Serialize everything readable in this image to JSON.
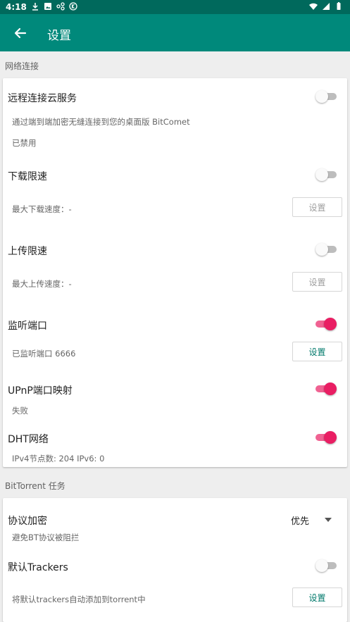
{
  "status_bar": {
    "time": "4:18"
  },
  "app_bar": {
    "title": "设置"
  },
  "sections": {
    "network": {
      "header": "网络连接",
      "remote": {
        "title": "远程连接云服务",
        "desc": "通过端到端加密无缝连接到您的桌面版 BitComet",
        "status": "已禁用",
        "enabled": false
      },
      "download_limit": {
        "title": "下载限速",
        "desc": "最大下载速度：-",
        "button": "设置",
        "enabled": false
      },
      "upload_limit": {
        "title": "上传限速",
        "desc": "最大上传速度：-",
        "button": "设置",
        "enabled": false
      },
      "listen_port": {
        "title": "监听端口",
        "desc": "已监听端口 6666",
        "button": "设置",
        "enabled": true
      },
      "upnp": {
        "title": "UPnP端口映射",
        "desc": "失败",
        "enabled": true
      },
      "dht": {
        "title": "DHT网络",
        "desc": "IPv4节点数: 204 IPv6:  0",
        "enabled": true
      }
    },
    "bittorrent": {
      "header": "BitTorrent 任务",
      "encryption": {
        "title": "协议加密",
        "desc": "避免BT协议被阻拦",
        "value": "优先"
      },
      "trackers": {
        "title": "默认Trackers",
        "desc": "将默认trackers自动添加到torrent中",
        "button": "设置",
        "enabled": false
      }
    }
  },
  "colors": {
    "app_bar": "#00897b",
    "status_bar": "#00695c",
    "accent": "#e91e63",
    "button_text": "#00796b"
  }
}
